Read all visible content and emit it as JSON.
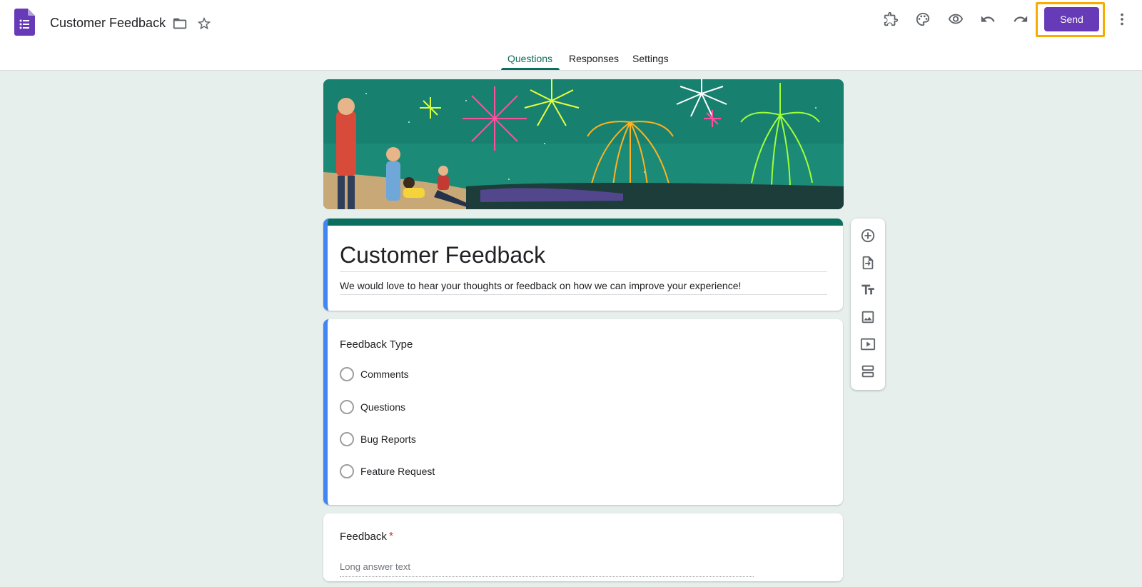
{
  "app": {
    "logo_icon": "google-forms-icon",
    "brand_color": "#673ab7"
  },
  "header": {
    "doc_title": "Customer Feedback",
    "send_label": "Send",
    "icons": [
      "folder-icon",
      "star-icon",
      "addons-icon",
      "palette-icon",
      "preview-eye-icon",
      "undo-icon",
      "redo-icon",
      "more-vert-icon"
    ]
  },
  "tabs": [
    {
      "label": "Questions",
      "active": true
    },
    {
      "label": "Responses",
      "active": false
    },
    {
      "label": "Settings",
      "active": false
    }
  ],
  "theme": {
    "accent": "#0b6e5f",
    "selected_border": "#4285f4",
    "background": "#e6efec"
  },
  "form": {
    "title": "Customer Feedback",
    "description": "We would love to hear your thoughts or feedback on how we can improve your experience!"
  },
  "questions": [
    {
      "title": "Feedback Type",
      "type": "multiple-choice",
      "options": [
        "Comments",
        "Questions",
        "Bug Reports",
        "Feature Request"
      ]
    },
    {
      "title": "Feedback",
      "required": true,
      "required_mark": "*",
      "placeholder": "Long answer text"
    }
  ],
  "toolbar": [
    "add-question-icon",
    "import-questions-icon",
    "add-title-icon",
    "add-image-icon",
    "add-video-icon",
    "add-section-icon"
  ]
}
